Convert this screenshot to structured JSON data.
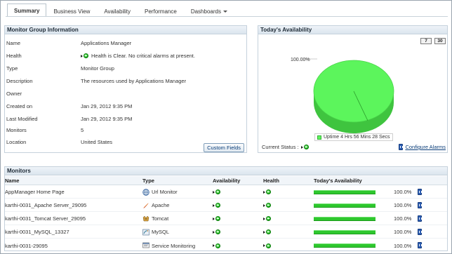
{
  "tabs": [
    {
      "label": "Summary",
      "active": true
    },
    {
      "label": "Business View"
    },
    {
      "label": "Availability"
    },
    {
      "label": "Performance"
    },
    {
      "label": "Dashboards"
    }
  ],
  "info_panel": {
    "title": "Monitor Group Information",
    "rows": [
      {
        "key": "Name",
        "value": "Applications Manager"
      },
      {
        "key": "Health",
        "value": "Health is Clear. No critical alarms at present."
      },
      {
        "key": "Type",
        "value": "Monitor Group"
      },
      {
        "key": "Description",
        "value": "The resources used by Applications Manager"
      },
      {
        "key": "Owner",
        "value": ""
      },
      {
        "key": "Created on",
        "value": "Jan 29, 2012 9:35 PM"
      },
      {
        "key": "Last Modified",
        "value": "Jan 29, 2012 9:35 PM"
      },
      {
        "key": "Monitors",
        "value": "5"
      },
      {
        "key": "Location",
        "value": "United States"
      }
    ],
    "custom_fields_label": "Custom Fields"
  },
  "availability_panel": {
    "title": "Today's Availability",
    "period_7": "7",
    "period_30": "30",
    "current_status_label": "Current Status :",
    "configure_alarms_label": "Configure Alarms"
  },
  "chart_data": {
    "type": "pie",
    "slices": [
      {
        "label": "Uptime 4 Hrs 56 Mins 28 Secs",
        "value": 100.0,
        "color": "#5cf55c"
      }
    ],
    "data_label": "100.00%",
    "legend": "Uptime 4 Hrs 56 Mins 28 Secs",
    "legend_position": "bottom"
  },
  "monitors_panel": {
    "title": "Monitors",
    "columns": [
      "Name",
      "Type",
      "Availability",
      "Health",
      "Today's Availability"
    ],
    "rows": [
      {
        "name": "AppManager Home Page",
        "type": "Url Monitor",
        "type_icon": "globe-icon",
        "availability_pct": 100,
        "pct": "100.0%"
      },
      {
        "name": "karthi-0031_Apache Server_29095",
        "type": "Apache",
        "type_icon": "apache-feather-icon",
        "availability_pct": 100,
        "pct": "100.0%"
      },
      {
        "name": "karthi-0031_Tomcat Server_29095",
        "type": "Tomcat",
        "type_icon": "tomcat-icon",
        "availability_pct": 100,
        "pct": "100.0%"
      },
      {
        "name": "karthi-0031_MySQL_13327",
        "type": "MySQL",
        "type_icon": "mysql-icon",
        "availability_pct": 100,
        "pct": "100.0%"
      },
      {
        "name": "karthi-0031-29095",
        "type": "Service Monitoring",
        "type_icon": "service-monitor-icon",
        "availability_pct": 100,
        "pct": "100.0%"
      }
    ]
  },
  "colors": {
    "uptime_green": "#5cf55c",
    "bar_green": "#2ec72e",
    "link_blue": "#0b3e7a"
  }
}
